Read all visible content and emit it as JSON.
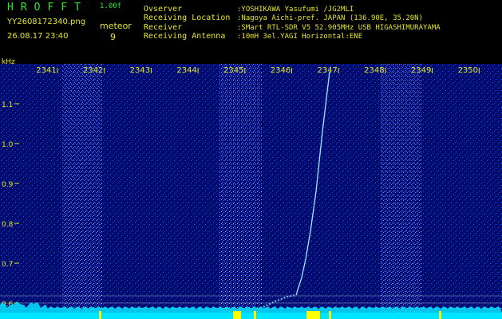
{
  "header": {
    "app_title": "HROFFT",
    "app_version": "1.00f",
    "file_name": "YY2608172340.png",
    "datetime": "26.08.17 23:40",
    "meteor_label": "meteor",
    "meteor_count": "9",
    "info": [
      {
        "key": "Ovserver",
        "value": ":YOSHIKAWA Yasufumi /JG2MLI"
      },
      {
        "key": "Receiving Location",
        "value": ":Nagoya Aichi-pref. JAPAN (136.90E, 35.20N)"
      },
      {
        "key": "Receiver",
        "value": ":SMart RTL-SDR V5 52.905MHz USB HIGASHIMURAYAMA"
      },
      {
        "key": "Receiving Antenna",
        "value": ":10mH 3el.YAGI Horizontal:ENE"
      }
    ]
  },
  "chart_data": {
    "type": "heatmap",
    "title": "",
    "ylabel": "kHz",
    "x_ticks": [
      "2341",
      "2342",
      "2343",
      "2344",
      "2345",
      "2346",
      "2347",
      "2348",
      "2349",
      "2350"
    ],
    "y_ticks": [
      "1.1",
      "1.0",
      "0.9",
      "0.8",
      "0.7",
      "0.6"
    ],
    "ylim": [
      0.58,
      1.2
    ],
    "colors": {
      "background": "#000b6e",
      "noise": "#2a56ff",
      "trace": "#9fe6ff",
      "baseline": "#00e5ff",
      "marker": "#ffff00",
      "axis_text": "#e6e628"
    }
  }
}
